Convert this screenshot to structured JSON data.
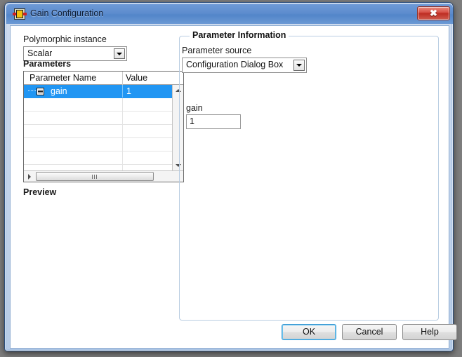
{
  "window": {
    "title": "Gain Configuration",
    "icon": "labview-vi-icon",
    "close_label": "✖",
    "accent_color": "#5d8cce",
    "close_color": "#bd2d22"
  },
  "left_panel": {
    "polymorphic_label": "Polymorphic instance",
    "polymorphic_value": "Scalar",
    "parameters_label": "Parameters",
    "preview_label": "Preview",
    "table": {
      "columns": [
        "Parameter Name",
        "Value"
      ],
      "rows": [
        {
          "name": "gain",
          "value": "1",
          "selected": true,
          "has_expander": true
        },
        {
          "name": "",
          "value": "",
          "selected": false,
          "has_expander": false
        },
        {
          "name": "",
          "value": "",
          "selected": false,
          "has_expander": false
        },
        {
          "name": "",
          "value": "",
          "selected": false,
          "has_expander": false
        },
        {
          "name": "",
          "value": "",
          "selected": false,
          "has_expander": false
        },
        {
          "name": "",
          "value": "",
          "selected": false,
          "has_expander": false
        },
        {
          "name": "",
          "value": "",
          "selected": false,
          "has_expander": false
        }
      ],
      "selection_color": "#2196f3"
    }
  },
  "right_panel": {
    "group_title": "Parameter Information",
    "source_label": "Parameter source",
    "source_value": "Configuration Dialog Box",
    "param_label": "gain",
    "param_value": "1"
  },
  "footer": {
    "ok_label": "OK",
    "cancel_label": "Cancel",
    "help_label": "Help"
  }
}
